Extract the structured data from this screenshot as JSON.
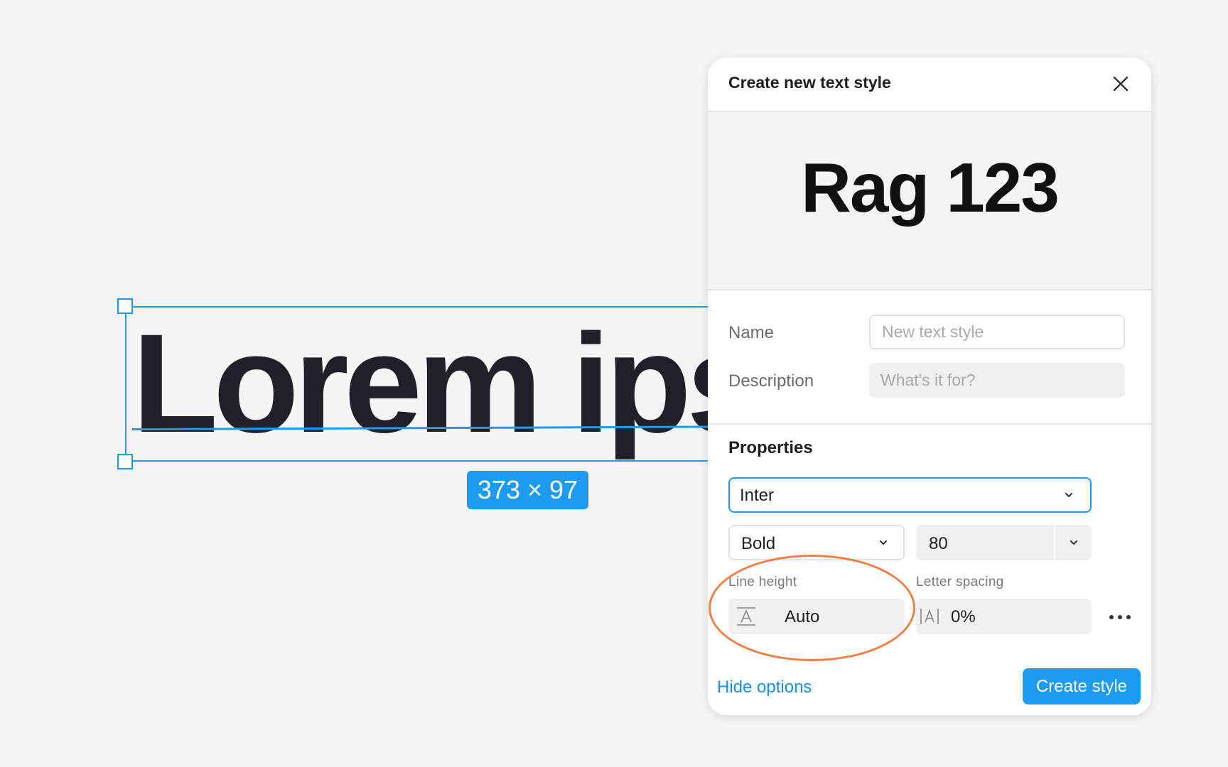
{
  "canvas": {
    "text": "Lorem ipsum",
    "size_badge": "373 × 97"
  },
  "dialog": {
    "title": "Create new text style",
    "preview_text": "Rag 123",
    "name_label": "Name",
    "name_placeholder": "New text style",
    "description_label": "Description",
    "description_placeholder": "What's it for?",
    "properties_title": "Properties",
    "font_family": "Inter",
    "font_weight": "Bold",
    "font_size": "80",
    "line_height_label": "Line height",
    "line_height_value": "Auto",
    "letter_spacing_label": "Letter spacing",
    "letter_spacing_value": "0%",
    "hide_options_label": "Hide options",
    "create_button_label": "Create style"
  },
  "icons": {
    "close": "close-icon",
    "chevron": "chevron-down-icon",
    "line_height": "line-height-icon",
    "letter_spacing": "letter-spacing-icon",
    "more": "more-icon"
  },
  "colors": {
    "accent": "#1e9bf0",
    "highlight": "#f27f45",
    "canvas_bg": "#f5f5f5"
  }
}
